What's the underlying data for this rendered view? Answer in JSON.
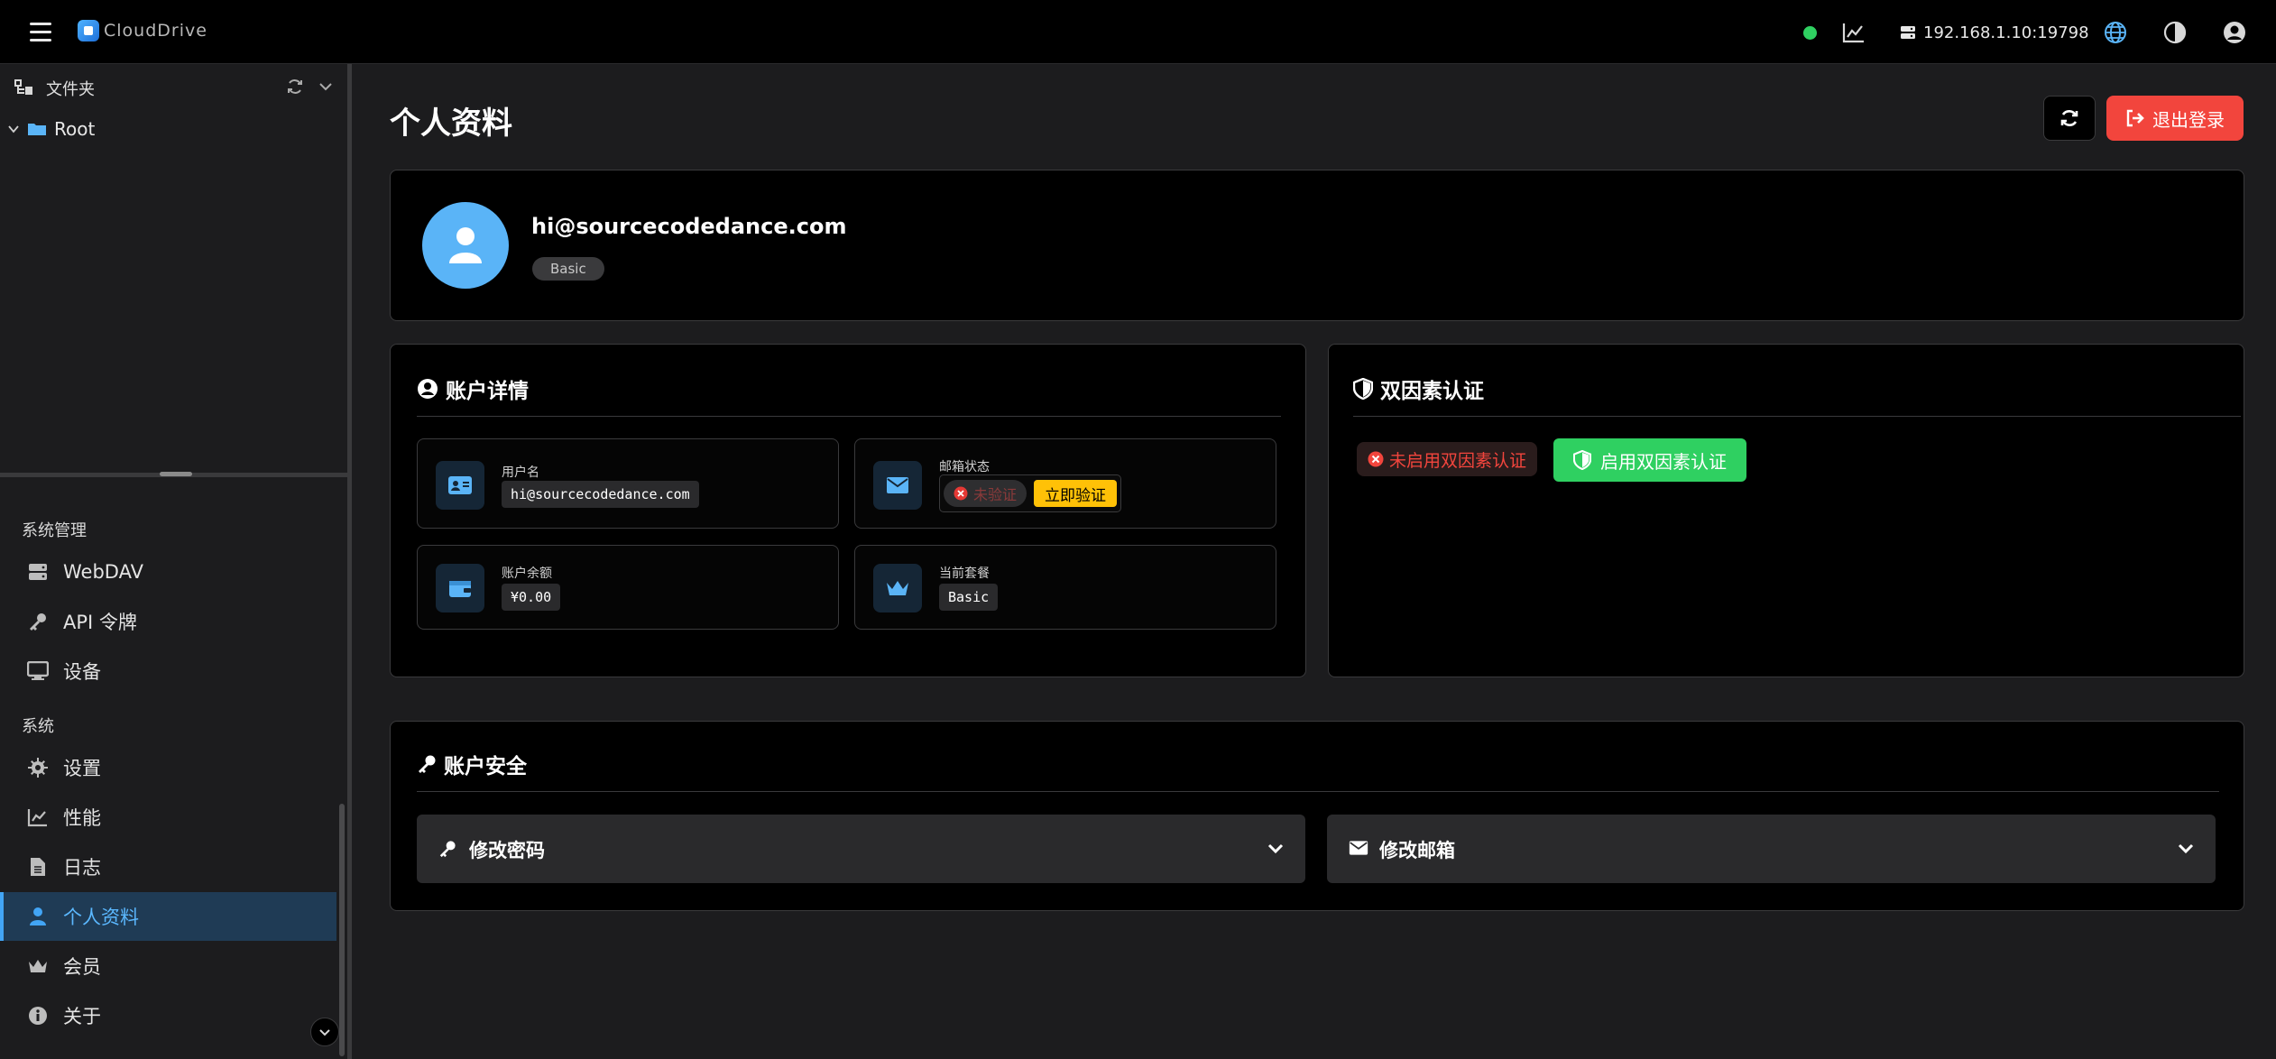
{
  "app": {
    "name": "CloudDrive"
  },
  "topbar": {
    "server_address": "192.168.1.10:19798",
    "status_color": "#2fd061"
  },
  "sidebar": {
    "folder_header": "文件夹",
    "tree_root": "Root",
    "groups": [
      {
        "title": "系统管理",
        "items": [
          {
            "label": "WebDAV",
            "icon": "server-icon"
          },
          {
            "label": "API 令牌",
            "icon": "key-icon"
          },
          {
            "label": "设备",
            "icon": "monitor-icon"
          }
        ]
      },
      {
        "title": "系统",
        "items": [
          {
            "label": "设置",
            "icon": "gear-icon"
          },
          {
            "label": "性能",
            "icon": "chart-line-icon"
          },
          {
            "label": "日志",
            "icon": "file-icon"
          },
          {
            "label": "个人资料",
            "icon": "user-icon",
            "active": true
          },
          {
            "label": "会员",
            "icon": "crown-icon"
          },
          {
            "label": "关于",
            "icon": "info-icon"
          }
        ]
      }
    ]
  },
  "main": {
    "title": "个人资料",
    "logout_label": "退出登录",
    "profile": {
      "email": "hi@sourcecodedance.com",
      "plan": "Basic"
    },
    "account_details": {
      "title": "账户详情",
      "username_label": "用户名",
      "username_value": "hi@sourcecodedance.com",
      "email_status_label": "邮箱状态",
      "email_status_value": "未验证",
      "verify_now_label": "立即验证",
      "balance_label": "账户余额",
      "balance_value": "¥0.00",
      "plan_label": "当前套餐",
      "plan_value": "Basic"
    },
    "two_factor": {
      "title": "双因素认证",
      "status": "未启用双因素认证",
      "enable_label": "启用双因素认证"
    },
    "security": {
      "title": "账户安全",
      "change_password": "修改密码",
      "change_email": "修改邮箱"
    }
  },
  "colors": {
    "accent": "#42a5f5",
    "danger": "#f2453d",
    "success": "#2fd061",
    "warning": "#ffc107"
  }
}
